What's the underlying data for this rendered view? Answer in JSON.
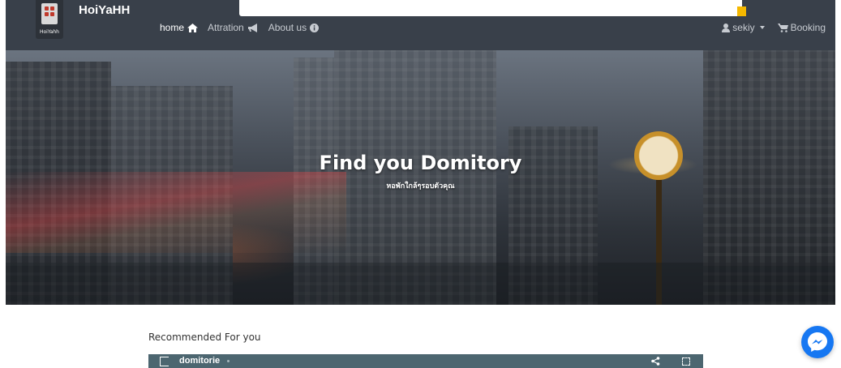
{
  "header": {
    "logo_text": "HoiYahh",
    "brand": "HoiYaHH",
    "nav": [
      {
        "label": "home",
        "icon": "home-icon"
      },
      {
        "label": "Attration",
        "icon": "megaphone-icon"
      },
      {
        "label": "About us",
        "icon": "info-icon"
      }
    ],
    "user": "sekiy",
    "booking": "Booking"
  },
  "hero": {
    "title": "Find you Domitory",
    "subtitle": "หอพักใกล้ๆรอบตัวคุณ"
  },
  "main": {
    "section_title": "Recommended For you",
    "embed_title": "domitorie"
  },
  "colors": {
    "header_bg": "#39404a",
    "accent": "#f5b800",
    "embed_bar": "#4c6670",
    "messenger": "#1677f2"
  }
}
